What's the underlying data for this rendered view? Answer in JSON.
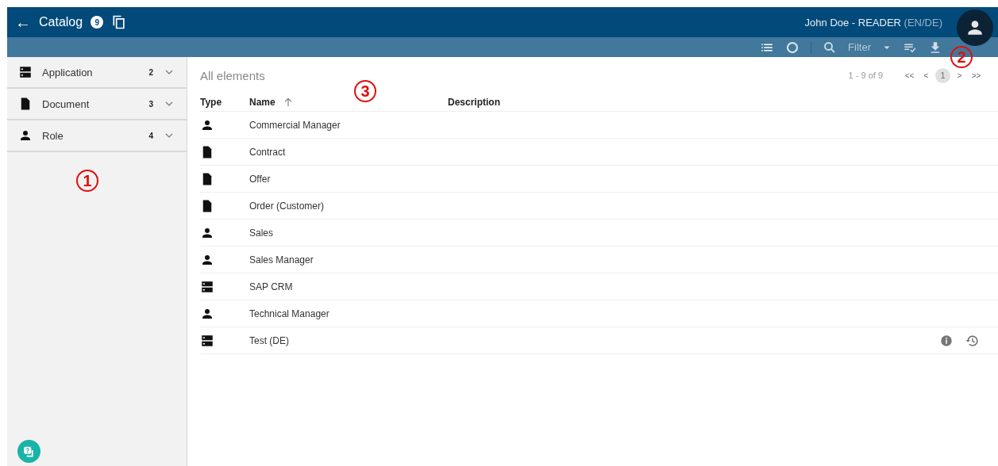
{
  "header": {
    "back": "←",
    "title": "Catalog",
    "count": "9",
    "user": "John Doe - READER",
    "locale": "(EN/DE)"
  },
  "toolbar": {
    "filter": "Filter"
  },
  "sidebar": {
    "items": [
      {
        "kind": "server",
        "label": "Application",
        "count": "2"
      },
      {
        "kind": "document",
        "label": "Document",
        "count": "3"
      },
      {
        "kind": "person",
        "label": "Role",
        "count": "4"
      }
    ]
  },
  "content": {
    "title": "All elements",
    "range": "1 - 9 of 9",
    "pages": [
      {
        "label": "<<",
        "selected": false
      },
      {
        "label": "<",
        "selected": false
      },
      {
        "label": "1",
        "selected": true
      },
      {
        "label": ">",
        "selected": false
      },
      {
        "label": ">>",
        "selected": false
      }
    ],
    "columns": [
      "Type",
      "Name",
      "Description"
    ],
    "rows": [
      {
        "kind": "person",
        "name": "Commercial Manager",
        "show_actions": false
      },
      {
        "kind": "document",
        "name": "Contract",
        "show_actions": false
      },
      {
        "kind": "document",
        "name": "Offer",
        "show_actions": false
      },
      {
        "kind": "document",
        "name": "Order (Customer)",
        "show_actions": false
      },
      {
        "kind": "person",
        "name": "Sales",
        "show_actions": false
      },
      {
        "kind": "person",
        "name": "Sales Manager",
        "show_actions": false
      },
      {
        "kind": "server",
        "name": "SAP CRM",
        "show_actions": false
      },
      {
        "kind": "person",
        "name": "Technical Manager",
        "show_actions": false
      },
      {
        "kind": "server",
        "name": "Test (DE)",
        "show_actions": true
      }
    ]
  },
  "callouts": [
    {
      "text": "1"
    },
    {
      "text": "2"
    },
    {
      "text": "3"
    }
  ]
}
